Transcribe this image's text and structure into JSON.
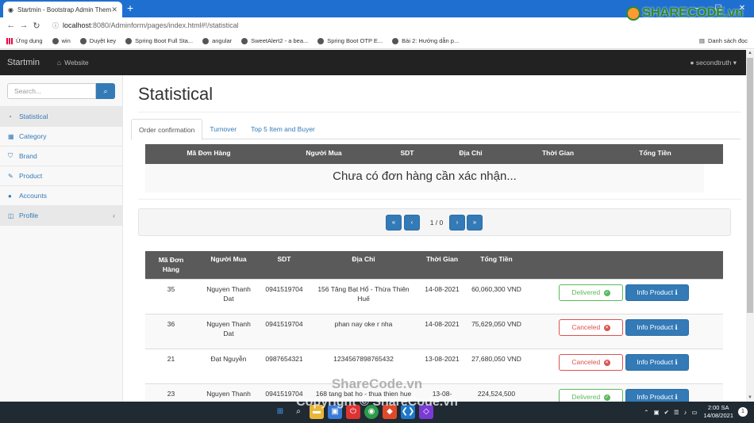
{
  "browser": {
    "tab_title": "Startmin - Bootstrap Admin Theme",
    "url_host": "localhost",
    "url_path": ":8080/Adminform/pages/index.html#!/statistical",
    "bookmarks": [
      "Ứng dụng",
      "win",
      "Duyệt key",
      "Spring Boot Full Sta...",
      "angular",
      "SweetAlert2 - a bea...",
      "Spring Boot OTP E...",
      "Bài 2: Hướng dẫn p..."
    ],
    "reading_list": "Danh sách đọc",
    "logo_text": "SHARECODE.vn"
  },
  "navbar": {
    "brand": "Startmin",
    "website_link": "Website",
    "user": "secondtruth"
  },
  "sidebar": {
    "search_placeholder": "Search...",
    "items": [
      {
        "label": "Statistical",
        "icon": "dashboard-icon"
      },
      {
        "label": "Category",
        "icon": "table-icon"
      },
      {
        "label": "Brand",
        "icon": "shield-icon"
      },
      {
        "label": "Product",
        "icon": "edit-icon"
      },
      {
        "label": "Accounts",
        "icon": "user-icon"
      },
      {
        "label": "Profile",
        "icon": "profile-icon"
      }
    ]
  },
  "main": {
    "title": "Statistical",
    "tabs": [
      "Order confirmation",
      "Turnover",
      "Top 5 Item and Buyer"
    ],
    "pending_headers": [
      "Mã Đơn Hàng",
      "Người Mua",
      "SDT",
      "Địa Chỉ",
      "Thời Gian",
      "Tổng Tiền"
    ],
    "empty_message": "Chưa có đơn hàng cần xác nhận...",
    "pager": {
      "info": "1 / 0",
      "first": "«",
      "prev": "‹",
      "next": "›",
      "last": "»"
    },
    "orders_headers": [
      "Mã Đơn Hàng",
      "Người Mua",
      "SDT",
      "Địa Chỉ",
      "Thời Gian",
      "Tổng Tiền"
    ],
    "orders": [
      {
        "id": "35",
        "buyer": "Nguyen Thanh Dat",
        "phone": "0941519704",
        "address": "156 Tăng Bạt Hổ - Thừa Thiên Huế",
        "date": "14-08-2021",
        "total": "60,060,300 VND",
        "status": "Delivered",
        "action": "Info Product"
      },
      {
        "id": "36",
        "buyer": "Nguyen Thanh Dat",
        "phone": "0941519704",
        "address": "phan nay oke r nha",
        "date": "14-08-2021",
        "total": "75,629,050 VND",
        "status": "Canceled",
        "action": "Info Product"
      },
      {
        "id": "21",
        "buyer": "Đạt Nguyễn",
        "phone": "0987654321",
        "address": "1234567898765432",
        "date": "13-08-2021",
        "total": "27,680,050 VND",
        "status": "Canceled",
        "action": "Info Product"
      },
      {
        "id": "23",
        "buyer": "Nguyen Thanh",
        "phone": "0941519704",
        "address": "168 tang bat ho - thua thien hue",
        "date": "13-08-",
        "total": "224,524,500",
        "status": "Delivered",
        "action": "Info Product"
      }
    ]
  },
  "taskbar": {
    "time": "2:00 SA",
    "date": "14/08/2021",
    "notifications": "1"
  },
  "watermarks": {
    "center": "ShareCode.vn",
    "bottom": "Copyright © ShareCode.vn"
  }
}
